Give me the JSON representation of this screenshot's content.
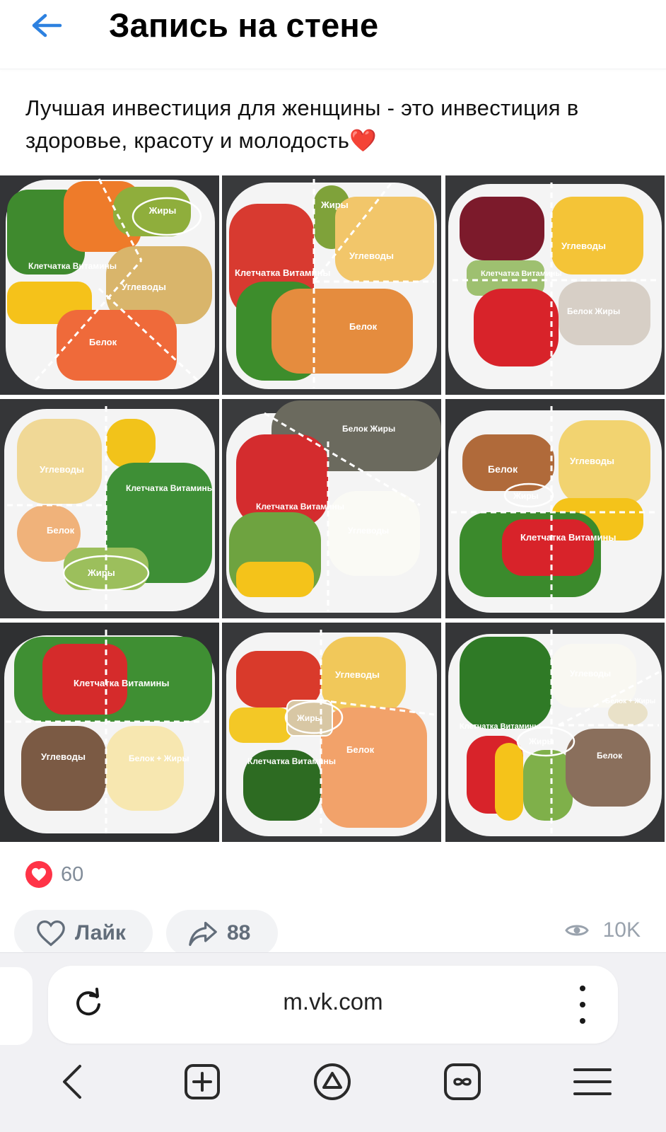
{
  "header": {
    "title": "Запись на стене",
    "back_icon": "arrow-left-icon",
    "accent": "#2d81e0"
  },
  "post": {
    "text": "Лучшая инвестиция для женщины - это инвестиция в здоровье, красоту и молодость❤️"
  },
  "grid": {
    "images": [
      {
        "labels": [
          "Жиры",
          "Клетчатка Витамины",
          "Углеводы",
          "Белок"
        ]
      },
      {
        "labels": [
          "Жиры",
          "Углеводы",
          "Клетчатка Витамины",
          "Белок"
        ]
      },
      {
        "labels": [
          "Углеводы",
          "Клетчатка Витамины",
          "Белок Жиры"
        ]
      },
      {
        "labels": [
          "Углеводы",
          "Клетчатка Витамины",
          "Белок",
          "Жиры"
        ]
      },
      {
        "labels": [
          "Белок Жиры",
          "Клетчатка Витамины",
          "Углеводы"
        ]
      },
      {
        "labels": [
          "Белок",
          "Углеводы",
          "Жиры",
          "Клетчатка Витамины"
        ]
      },
      {
        "labels": [
          "Клетчатка Витамины",
          "Углеводы",
          "Белок + Жиры"
        ]
      },
      {
        "labels": [
          "Углеводы",
          "Жиры",
          "Клетчатка Витамины",
          "Белок"
        ]
      },
      {
        "labels": [
          "Углеводы",
          "Белок + Жиры",
          "Клетчатка Витамины",
          "Жиры",
          "Белок"
        ]
      }
    ]
  },
  "reactions": {
    "count": "60",
    "icon": "heart-filled-icon",
    "color": "#ff3347"
  },
  "actions": {
    "like_label": "Лайк",
    "share_count": "88",
    "views_count": "10K"
  },
  "browser": {
    "url": "m.vk.com"
  }
}
